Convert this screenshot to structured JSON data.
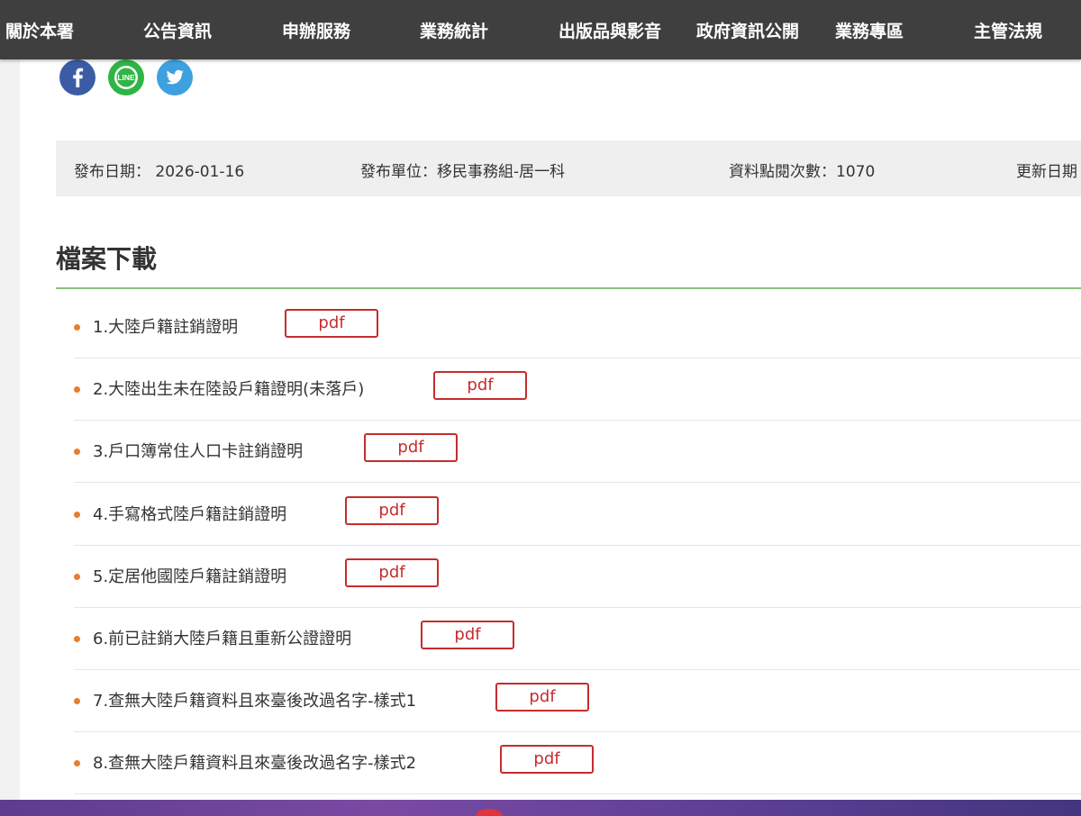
{
  "nav": {
    "items": [
      "關於本署",
      "公告資訊",
      "申辦服務",
      "業務統計",
      "出版品與影音",
      "政府資訊公開",
      "業務專區",
      "主管法規"
    ]
  },
  "share": {
    "icons": [
      "facebook-icon",
      "line-icon",
      "twitter-icon"
    ],
    "line_label": "LINE"
  },
  "meta": {
    "publish_date_label": "發布日期：",
    "publish_date": "2026-01-16",
    "unit_label": "發布單位：",
    "unit": "移民事務組-居一科",
    "views_label": "資料點閱次數：",
    "views": "1070",
    "updated_label": "更新日期"
  },
  "section": {
    "title": "檔案下載"
  },
  "files": [
    {
      "name": "1.大陸戶籍註銷證明",
      "format": "pdf"
    },
    {
      "name": "2.大陸出生未在陸設戶籍證明(未落戶)",
      "format": "pdf"
    },
    {
      "name": "3.戶口簿常住人口卡註銷證明",
      "format": "pdf"
    },
    {
      "name": "4.手寫格式陸戶籍註銷證明",
      "format": "pdf"
    },
    {
      "name": "5.定居他國陸戶籍註銷證明",
      "format": "pdf"
    },
    {
      "name": "6.前已註銷大陸戶籍且重新公證證明",
      "format": "pdf"
    },
    {
      "name": "7.查無大陸戶籍資料且來臺後改過名字-樣式1",
      "format": "pdf"
    },
    {
      "name": "8.查無大陸戶籍資料且來臺後改過名字-樣式2",
      "format": "pdf"
    }
  ],
  "colors": {
    "nav_bg": "#3f3f3f",
    "accent_green": "#8bc07a",
    "bullet_orange": "#e87d2e",
    "pdf_red": "#c62d2d"
  }
}
